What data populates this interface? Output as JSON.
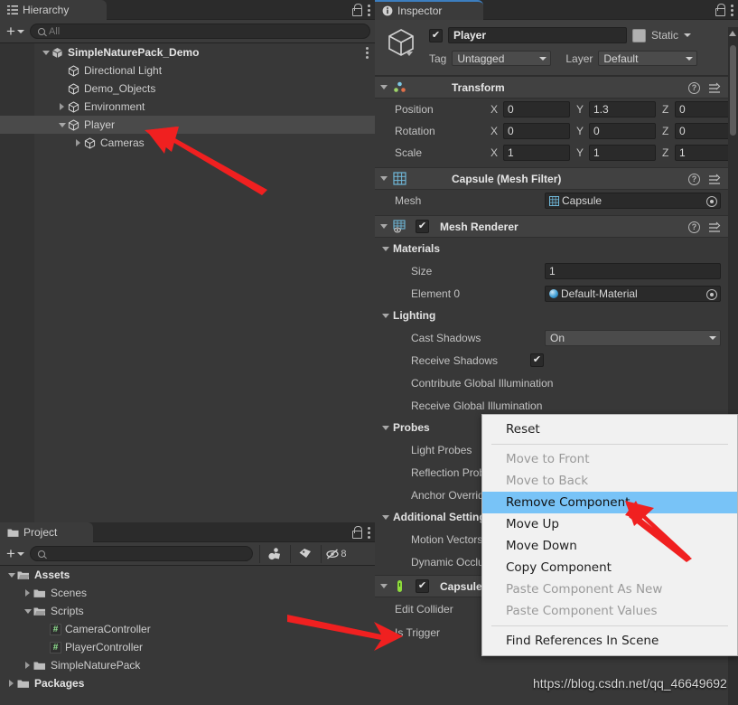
{
  "hierarchy": {
    "tab_label": "Hierarchy",
    "lock_icon": "lock-icon",
    "menu_icon": "kebab-menu-icon",
    "toolbar": {
      "add_label": "+",
      "search_placeholder": "All",
      "search_value": "",
      "search_icon": "search-icon"
    },
    "items": [
      {
        "label": "SimpleNaturePack_Demo",
        "depth": 1,
        "icon": "prefab-icon",
        "expanded": true,
        "bold": true,
        "selected": false,
        "has_children": true
      },
      {
        "label": "Directional Light",
        "depth": 2,
        "icon": "gameobject-icon",
        "expanded": false,
        "bold": false,
        "selected": false,
        "has_children": false
      },
      {
        "label": "Demo_Objects",
        "depth": 2,
        "icon": "gameobject-icon",
        "expanded": false,
        "bold": false,
        "selected": false,
        "has_children": false
      },
      {
        "label": "Environment",
        "depth": 2,
        "icon": "gameobject-icon",
        "expanded": false,
        "bold": false,
        "selected": false,
        "has_children": true
      },
      {
        "label": "Player",
        "depth": 2,
        "icon": "gameobject-icon",
        "expanded": true,
        "bold": false,
        "selected": true,
        "has_children": true
      },
      {
        "label": "Cameras",
        "depth": 3,
        "icon": "gameobject-icon",
        "expanded": false,
        "bold": false,
        "selected": false,
        "has_children": true
      }
    ]
  },
  "project": {
    "tab_label": "Project",
    "lock_icon": "lock-icon",
    "menu_icon": "kebab-menu-icon",
    "toolbar": {
      "add_label": "+",
      "search_placeholder": "",
      "search_value": "",
      "search_icon": "search-icon",
      "buttons": [
        {
          "name": "filter-by-type-icon",
          "label": ""
        },
        {
          "name": "filter-by-label-icon",
          "label": ""
        },
        {
          "name": "hidden-packages-icon",
          "label": "8"
        }
      ]
    },
    "items": [
      {
        "label": "Assets",
        "depth": 0,
        "icon": "folder-open-icon",
        "expanded": true,
        "bold": true,
        "has_children": true
      },
      {
        "label": "Scenes",
        "depth": 1,
        "icon": "folder-icon",
        "expanded": false,
        "bold": false,
        "has_children": true
      },
      {
        "label": "Scripts",
        "depth": 1,
        "icon": "folder-open-icon",
        "expanded": true,
        "bold": false,
        "has_children": true
      },
      {
        "label": "CameraController",
        "depth": 2,
        "icon": "csharp-script-icon",
        "expanded": false,
        "bold": false,
        "has_children": false
      },
      {
        "label": "PlayerController",
        "depth": 2,
        "icon": "csharp-script-icon",
        "expanded": false,
        "bold": false,
        "has_children": false
      },
      {
        "label": "SimpleNaturePack",
        "depth": 1,
        "icon": "folder-icon",
        "expanded": false,
        "bold": false,
        "has_children": true
      },
      {
        "label": "Packages",
        "depth": 0,
        "icon": "folder-icon",
        "expanded": false,
        "bold": true,
        "has_children": true
      }
    ]
  },
  "inspector": {
    "tab_label": "Inspector",
    "tab_icon": "info-icon",
    "lock_icon": "lock-icon",
    "menu_icon": "kebab-menu-icon",
    "gameobject": {
      "icon": "gameobject-icon",
      "enabled": true,
      "name": "Player",
      "static_label": "Static",
      "static_checked": false,
      "tag_label": "Tag",
      "tag_value": "Untagged",
      "layer_label": "Layer",
      "layer_value": "Default"
    },
    "components": [
      {
        "title": "Transform",
        "icon": "transform-icon",
        "has_checkbox": false,
        "expanded": true,
        "rows": [
          {
            "name": "Position",
            "x": "0",
            "y": "1.3",
            "z": "0"
          },
          {
            "name": "Rotation",
            "x": "0",
            "y": "0",
            "z": "0"
          },
          {
            "name": "Scale",
            "x": "1",
            "y": "1",
            "z": "1"
          }
        ]
      },
      {
        "title": "Capsule (Mesh Filter)",
        "icon": "mesh-filter-icon",
        "has_checkbox": false,
        "expanded": true,
        "mesh_label": "Mesh",
        "mesh_value": "Capsule"
      },
      {
        "title": "Mesh Renderer",
        "icon": "mesh-renderer-icon",
        "has_checkbox": true,
        "checked": true,
        "expanded": true,
        "groups": [
          {
            "name": "Materials",
            "fields": [
              {
                "label": "Size",
                "value": "1",
                "type": "number"
              },
              {
                "label": "Element 0",
                "value": "Default-Material",
                "type": "object"
              }
            ]
          },
          {
            "name": "Lighting",
            "fields": [
              {
                "label": "Cast Shadows",
                "value": "On",
                "type": "dropdown"
              },
              {
                "label": "Receive Shadows",
                "value": "",
                "type": "checkbox",
                "checked": true
              },
              {
                "label": "Contribute Global Illumination",
                "value": "",
                "type": "checkbox",
                "checked": false
              },
              {
                "label": "Receive Global Illumination",
                "value": "",
                "type": "dropdown",
                "disabled": true
              }
            ]
          },
          {
            "name": "Probes",
            "fields": [
              {
                "label": "Light Probes",
                "value": "",
                "type": "dropdown"
              },
              {
                "label": "Reflection Probes",
                "value": "",
                "type": "dropdown"
              },
              {
                "label": "Anchor Override",
                "value": "",
                "type": "object"
              }
            ]
          },
          {
            "name": "Additional Settings",
            "fields": [
              {
                "label": "Motion Vectors",
                "value": "",
                "type": "dropdown"
              },
              {
                "label": "Dynamic Occlusion",
                "value": "",
                "type": "checkbox"
              }
            ]
          }
        ]
      },
      {
        "title": "Capsule Collider",
        "icon": "capsule-collider-icon",
        "has_checkbox": true,
        "checked": true,
        "expanded": true,
        "rows_simple": [
          {
            "label": "Edit Collider",
            "value": ""
          },
          {
            "label": "Is Trigger",
            "value": ""
          }
        ]
      }
    ]
  },
  "context_menu": {
    "items": [
      {
        "label": "Reset",
        "state": "normal"
      },
      {
        "label": "__separator__",
        "state": "separator"
      },
      {
        "label": "Move to Front",
        "state": "disabled"
      },
      {
        "label": "Move to Back",
        "state": "disabled"
      },
      {
        "label": "Remove Component",
        "state": "highlighted"
      },
      {
        "label": "Move Up",
        "state": "normal"
      },
      {
        "label": "Move Down",
        "state": "normal"
      },
      {
        "label": "Copy Component",
        "state": "normal"
      },
      {
        "label": "Paste Component As New",
        "state": "disabled"
      },
      {
        "label": "Paste Component Values",
        "state": "disabled"
      },
      {
        "label": "__separator__",
        "state": "separator"
      },
      {
        "label": "Find References In Scene",
        "state": "normal"
      }
    ]
  },
  "watermark": {
    "text": "https://blog.csdn.net/qq_46649692"
  },
  "colors": {
    "panel_bg": "#383838",
    "header_bg": "#3b3b3b",
    "selection": "#4a4a4a",
    "menu_highlight": "#78c3f7",
    "accent_tab": "#3c7ebf",
    "arrow_red": "#f02020"
  }
}
